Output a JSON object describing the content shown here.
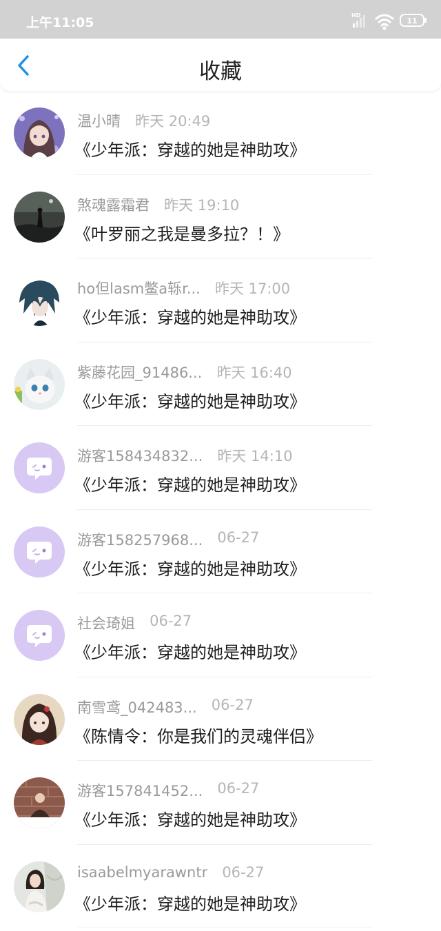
{
  "status_bar": {
    "time": "上午11:05",
    "hd_label": "HD",
    "battery": "11"
  },
  "header": {
    "title": "收藏"
  },
  "items": [
    {
      "user": "温小晴",
      "time": "昨天 20:49",
      "book": "《少年派：穿越的她是神助攻》",
      "avatar": "anime-girl"
    },
    {
      "user": "煞魂露霜君",
      "time": "昨天 19:10",
      "book": "《叶罗丽之我是曼多拉？！》",
      "avatar": "dark-scene"
    },
    {
      "user": "ho但lasm鳖a轹r...",
      "time": "昨天 17:00",
      "book": "《少年派：穿越的她是神助攻》",
      "avatar": "anime-boy"
    },
    {
      "user": "紫藤花园_91486...",
      "time": "昨天 16:40",
      "book": "《少年派：穿越的她是神助攻》",
      "avatar": "cat"
    },
    {
      "user": "游客158434832...",
      "time": "昨天 14:10",
      "book": "《少年派：穿越的她是神助攻》",
      "avatar": "default"
    },
    {
      "user": "游客158257968...",
      "time": "06-27",
      "book": "《少年派：穿越的她是神助攻》",
      "avatar": "default"
    },
    {
      "user": "社会琦姐",
      "time": "06-27",
      "book": "《少年派：穿越的她是神助攻》",
      "avatar": "default"
    },
    {
      "user": "南雪鸢_042483...",
      "time": "06-27",
      "book": "《陈情令：你是我们的灵魂伴侣》",
      "avatar": "ancient-girl"
    },
    {
      "user": "游客157841452...",
      "time": "06-27",
      "book": "《少年派：穿越的她是神助攻》",
      "avatar": "photo-wall"
    },
    {
      "user": "isaabelmyarawntr",
      "time": "06-27",
      "book": "《少年派：穿越的她是神助攻》",
      "avatar": "photo-girl"
    }
  ]
}
